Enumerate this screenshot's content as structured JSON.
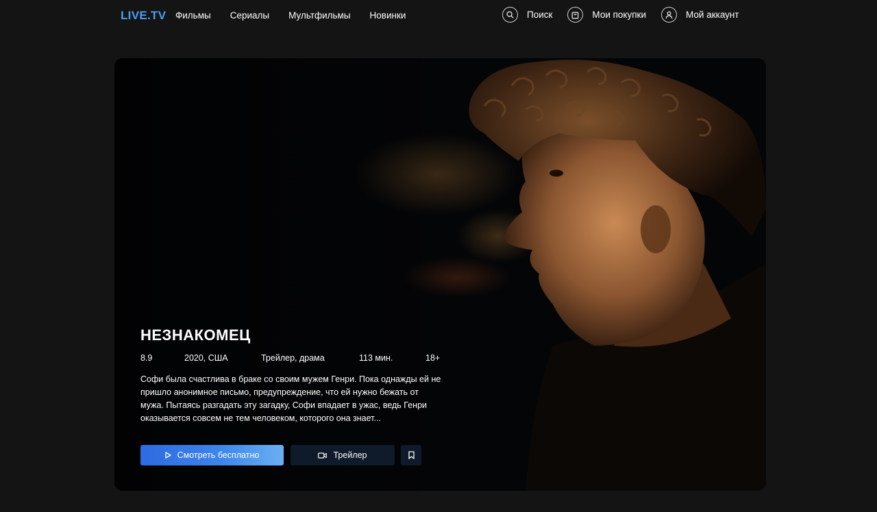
{
  "header": {
    "logo": "LIVE.TV",
    "nav": [
      "Фильмы",
      "Сериалы",
      "Мультфильмы",
      "Новинки"
    ],
    "search_label": "Поиск",
    "purchases_label": "Мои покупки",
    "account_label": "Мой аккаунт"
  },
  "movie": {
    "title": "НЕЗНАКОМЕЦ",
    "rating": "8.9",
    "year_country": "2020, США",
    "genre": "Трейлер, драма",
    "duration": "113 мин.",
    "age": "18+",
    "description": "Софи была счастлива в браке со своим мужем Генри. Пока однажды ей не пришло анонимное письмо, предупреждение, что ей нужно бежать от мужа. Пытаясь разгадать эту загадку, Софи впадает в ужас, ведь Генри оказывается совсем не тем человеком, которого она знает...",
    "watch_label": "Смотреть бесплатно",
    "trailer_label": "Трейлер"
  },
  "colors": {
    "background": "#141414",
    "logo": "#4a9ff5",
    "watch_button_start": "#2f6ae0",
    "watch_button_end": "#6bb0f4",
    "secondary_button": "#0f1a2a"
  },
  "icons": {
    "search": "search-icon",
    "purchases": "shopping-bag-icon",
    "account": "user-icon",
    "play": "play-icon",
    "trailer": "video-camera-icon",
    "bookmark": "bookmark-icon"
  }
}
